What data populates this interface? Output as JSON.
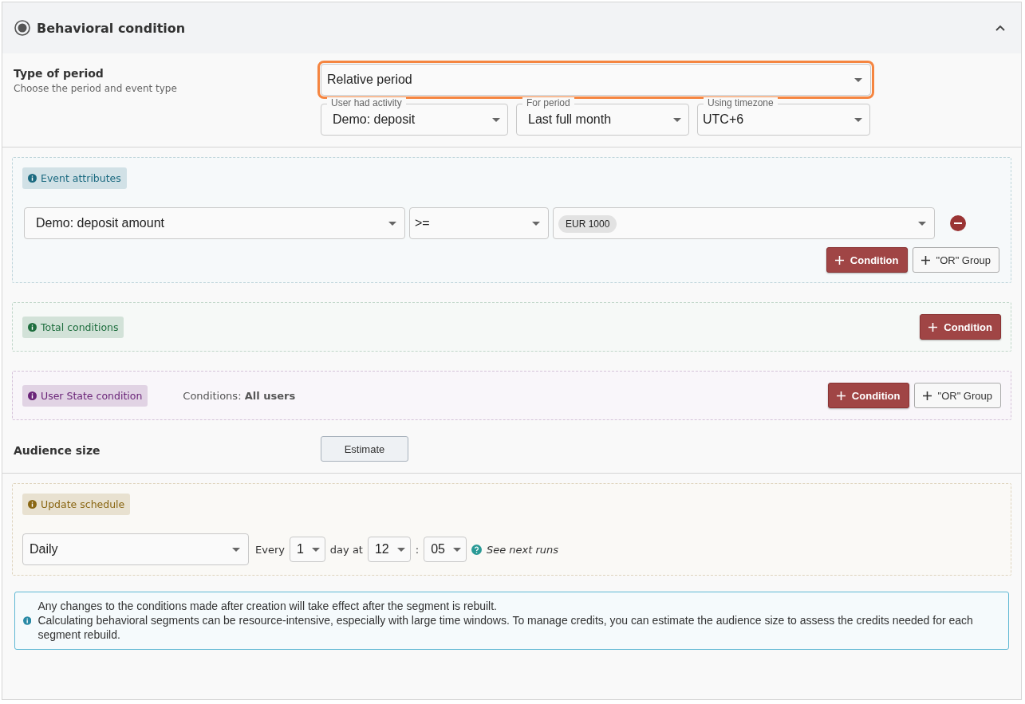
{
  "header": {
    "title": "Behavioral condition",
    "selected": true,
    "expanded": true
  },
  "period": {
    "label": "Type of period",
    "hint": "Choose the period and event type",
    "type_select": {
      "value": "Relative period",
      "highlighted": true
    },
    "selects": [
      {
        "label": "User had activity",
        "value": "Demo: deposit"
      },
      {
        "label": "For period",
        "value": "Last full month"
      },
      {
        "label": "Using timezone",
        "value": "UTC+6"
      }
    ]
  },
  "event_attributes": {
    "tag": "Event attributes",
    "color": "#1b6a80",
    "filter": {
      "attribute": "Demo: deposit amount",
      "operator": ">=",
      "chips": [
        "EUR 1000"
      ]
    },
    "buttons": [
      {
        "kind": "primary",
        "label": "Condition"
      },
      {
        "kind": "secondary",
        "label": "\"OR\" Group"
      }
    ]
  },
  "total_conditions": {
    "tag": "Total conditions",
    "color": "#1e6e3e",
    "buttons": [
      {
        "kind": "primary",
        "label": "Condition"
      }
    ]
  },
  "user_state": {
    "tag": "User State condition",
    "color": "#6a2478",
    "summary_label": "Conditions:",
    "summary_value": "All users",
    "buttons": [
      {
        "kind": "primary",
        "label": "Condition"
      },
      {
        "kind": "secondary",
        "label": "\"OR\" Group"
      }
    ]
  },
  "audience": {
    "label": "Audience size",
    "button": "Estimate"
  },
  "schedule": {
    "tag": "Update schedule",
    "color": "#8a6714",
    "frequency": "Daily",
    "every_label": "Every",
    "interval": "1",
    "day_at_label": "day at",
    "hour": "12",
    "separator": ":",
    "minute": "05",
    "help_link": "See next runs"
  },
  "notice": {
    "lines": [
      "Any changes to the conditions made after creation will take effect after the segment is rebuilt.",
      "Calculating behavioral segments can be resource-intensive, especially with large time windows. To manage credits, you can estimate the audience size to assess the credits needed for each segment rebuild."
    ]
  }
}
